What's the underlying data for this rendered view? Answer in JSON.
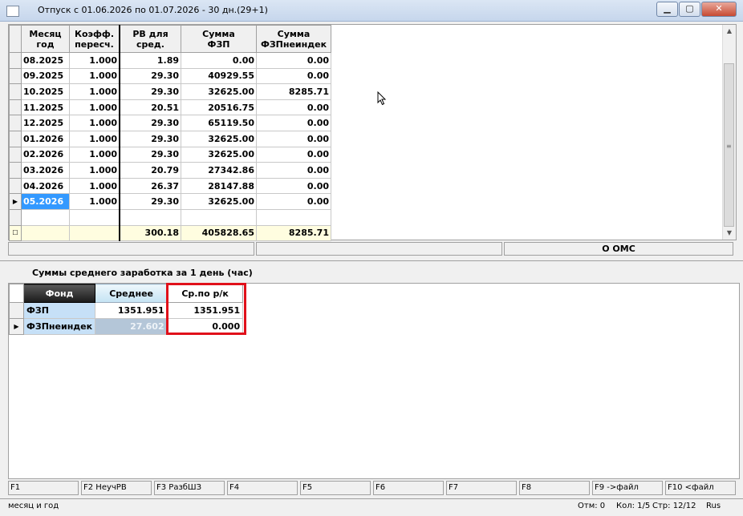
{
  "window": {
    "title": "Отпуск с 01.06.2026 по 01.07.2026 - 30 дн.(29+1)",
    "minimize": "▁",
    "maximize": "▢",
    "close": "✕"
  },
  "grid1": {
    "headers": {
      "month": [
        "Месяц",
        "год"
      ],
      "coef": [
        "Коэфф.",
        "пересч."
      ],
      "rv": [
        "РВ для",
        "сред."
      ],
      "sum_fzp": [
        "Сумма",
        "ФЗП"
      ],
      "sum_fzpn": [
        "Сумма",
        "ФЗПнеиндек"
      ]
    },
    "rows": [
      {
        "month": "08.2025",
        "coef": "1.000",
        "rv": "1.89",
        "fzp": "0.00",
        "fzpn": "0.00"
      },
      {
        "month": "09.2025",
        "coef": "1.000",
        "rv": "29.30",
        "fzp": "40929.55",
        "fzpn": "0.00"
      },
      {
        "month": "10.2025",
        "coef": "1.000",
        "rv": "29.30",
        "fzp": "32625.00",
        "fzpn": "8285.71"
      },
      {
        "month": "11.2025",
        "coef": "1.000",
        "rv": "20.51",
        "fzp": "20516.75",
        "fzpn": "0.00"
      },
      {
        "month": "12.2025",
        "coef": "1.000",
        "rv": "29.30",
        "fzp": "65119.50",
        "fzpn": "0.00"
      },
      {
        "month": "01.2026",
        "coef": "1.000",
        "rv": "29.30",
        "fzp": "32625.00",
        "fzpn": "0.00"
      },
      {
        "month": "02.2026",
        "coef": "1.000",
        "rv": "29.30",
        "fzp": "32625.00",
        "fzpn": "0.00"
      },
      {
        "month": "03.2026",
        "coef": "1.000",
        "rv": "20.79",
        "fzp": "27342.86",
        "fzpn": "0.00"
      },
      {
        "month": "04.2026",
        "coef": "1.000",
        "rv": "26.37",
        "fzp": "28147.88",
        "fzpn": "0.00"
      },
      {
        "month": "05.2026",
        "coef": "1.000",
        "rv": "29.30",
        "fzp": "32625.00",
        "fzpn": "0.00"
      }
    ],
    "selected_row": 9,
    "row_indicator": "▶",
    "totals": {
      "rv": "300.18",
      "fzp": "405828.65",
      "fzpn": "8285.71"
    }
  },
  "status_row": {
    "oms": "О ОМС"
  },
  "panel": {
    "title": "Суммы среднего заработка за 1 день (час)"
  },
  "grid2": {
    "headers": {
      "fond": "Фонд",
      "avg": "Среднее",
      "avg_rk": "Ср.по р/к"
    },
    "rows": [
      {
        "fond": "ФЗП",
        "avg": "1351.951",
        "avg_rk": "1351.951"
      },
      {
        "fond": "ФЗПнеиндек",
        "avg": "27.602",
        "avg_rk": "0.000"
      }
    ]
  },
  "fkeys": [
    "F1",
    "F2 НеучРВ",
    "F3 РазбШЗ",
    "F4",
    "F5",
    "F6",
    "F7",
    "F8",
    "F9 ->файл",
    "F10 <файл"
  ],
  "statusbar": {
    "hint": "месяц и год",
    "otm": "Отм: 0",
    "col": "Кол: 1/5",
    "row": "Стр: 12/12",
    "lang": "Rus"
  },
  "colors": {
    "selection": "#3399ff",
    "total_bg": "#fffde0",
    "highlight_box": "#e0101a"
  }
}
